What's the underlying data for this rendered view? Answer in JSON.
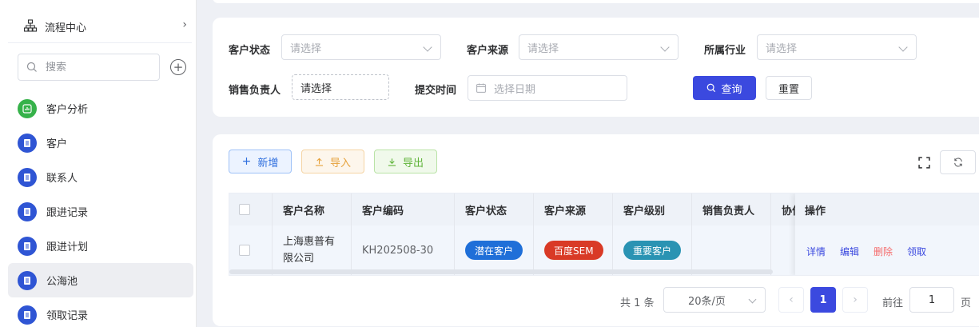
{
  "sidebar": {
    "flow_center": "流程中心",
    "search_placeholder": "搜索",
    "items": [
      {
        "label": "客户分析",
        "icon": "chart-icon",
        "color": "#36b24a"
      },
      {
        "label": "客户",
        "icon": "doc-icon",
        "color": "#2f55d4"
      },
      {
        "label": "联系人",
        "icon": "doc-icon",
        "color": "#2f55d4"
      },
      {
        "label": "跟进记录",
        "icon": "doc-icon",
        "color": "#2f55d4"
      },
      {
        "label": "跟进计划",
        "icon": "doc-icon",
        "color": "#2f55d4"
      },
      {
        "label": "公海池",
        "icon": "doc-icon",
        "color": "#2f55d4",
        "active": true
      },
      {
        "label": "领取记录",
        "icon": "doc-icon",
        "color": "#2f55d4"
      }
    ]
  },
  "filters": {
    "status_label": "客户状态",
    "status_placeholder": "请选择",
    "source_label": "客户来源",
    "source_placeholder": "请选择",
    "industry_label": "所属行业",
    "industry_placeholder": "请选择",
    "owner_label": "销售负责人",
    "owner_value": "请选择",
    "time_label": "提交时间",
    "time_placeholder": "选择日期",
    "search_btn": "查询",
    "reset_btn": "重置"
  },
  "toolbar": {
    "add": "新增",
    "import": "导入",
    "export": "导出"
  },
  "table": {
    "headers": {
      "name": "客户名称",
      "code": "客户编码",
      "status": "客户状态",
      "source": "客户来源",
      "level": "客户级别",
      "owner": "销售负责人",
      "collab": "协作",
      "ops": "操作"
    },
    "rows": [
      {
        "name": "上海惠普有限公司",
        "code": "KH202508-30",
        "status": "潜在客户",
        "source": "百度SEM",
        "level": "重要客户",
        "ops": {
          "detail": "详情",
          "edit": "编辑",
          "delete": "删除",
          "claim": "领取"
        }
      }
    ]
  },
  "colors": {
    "primary": "#3b49df",
    "tag_status": "#1f6fd8",
    "tag_source": "#d93a26",
    "tag_level": "#2a93b3",
    "link_blue": "#3b49df",
    "link_red": "#f56c6c"
  },
  "pagination": {
    "total_text": "共 1 条",
    "page_size": "20条/页",
    "current": "1",
    "goto_label": "前往",
    "goto_value": "1",
    "page_suffix": "页"
  }
}
